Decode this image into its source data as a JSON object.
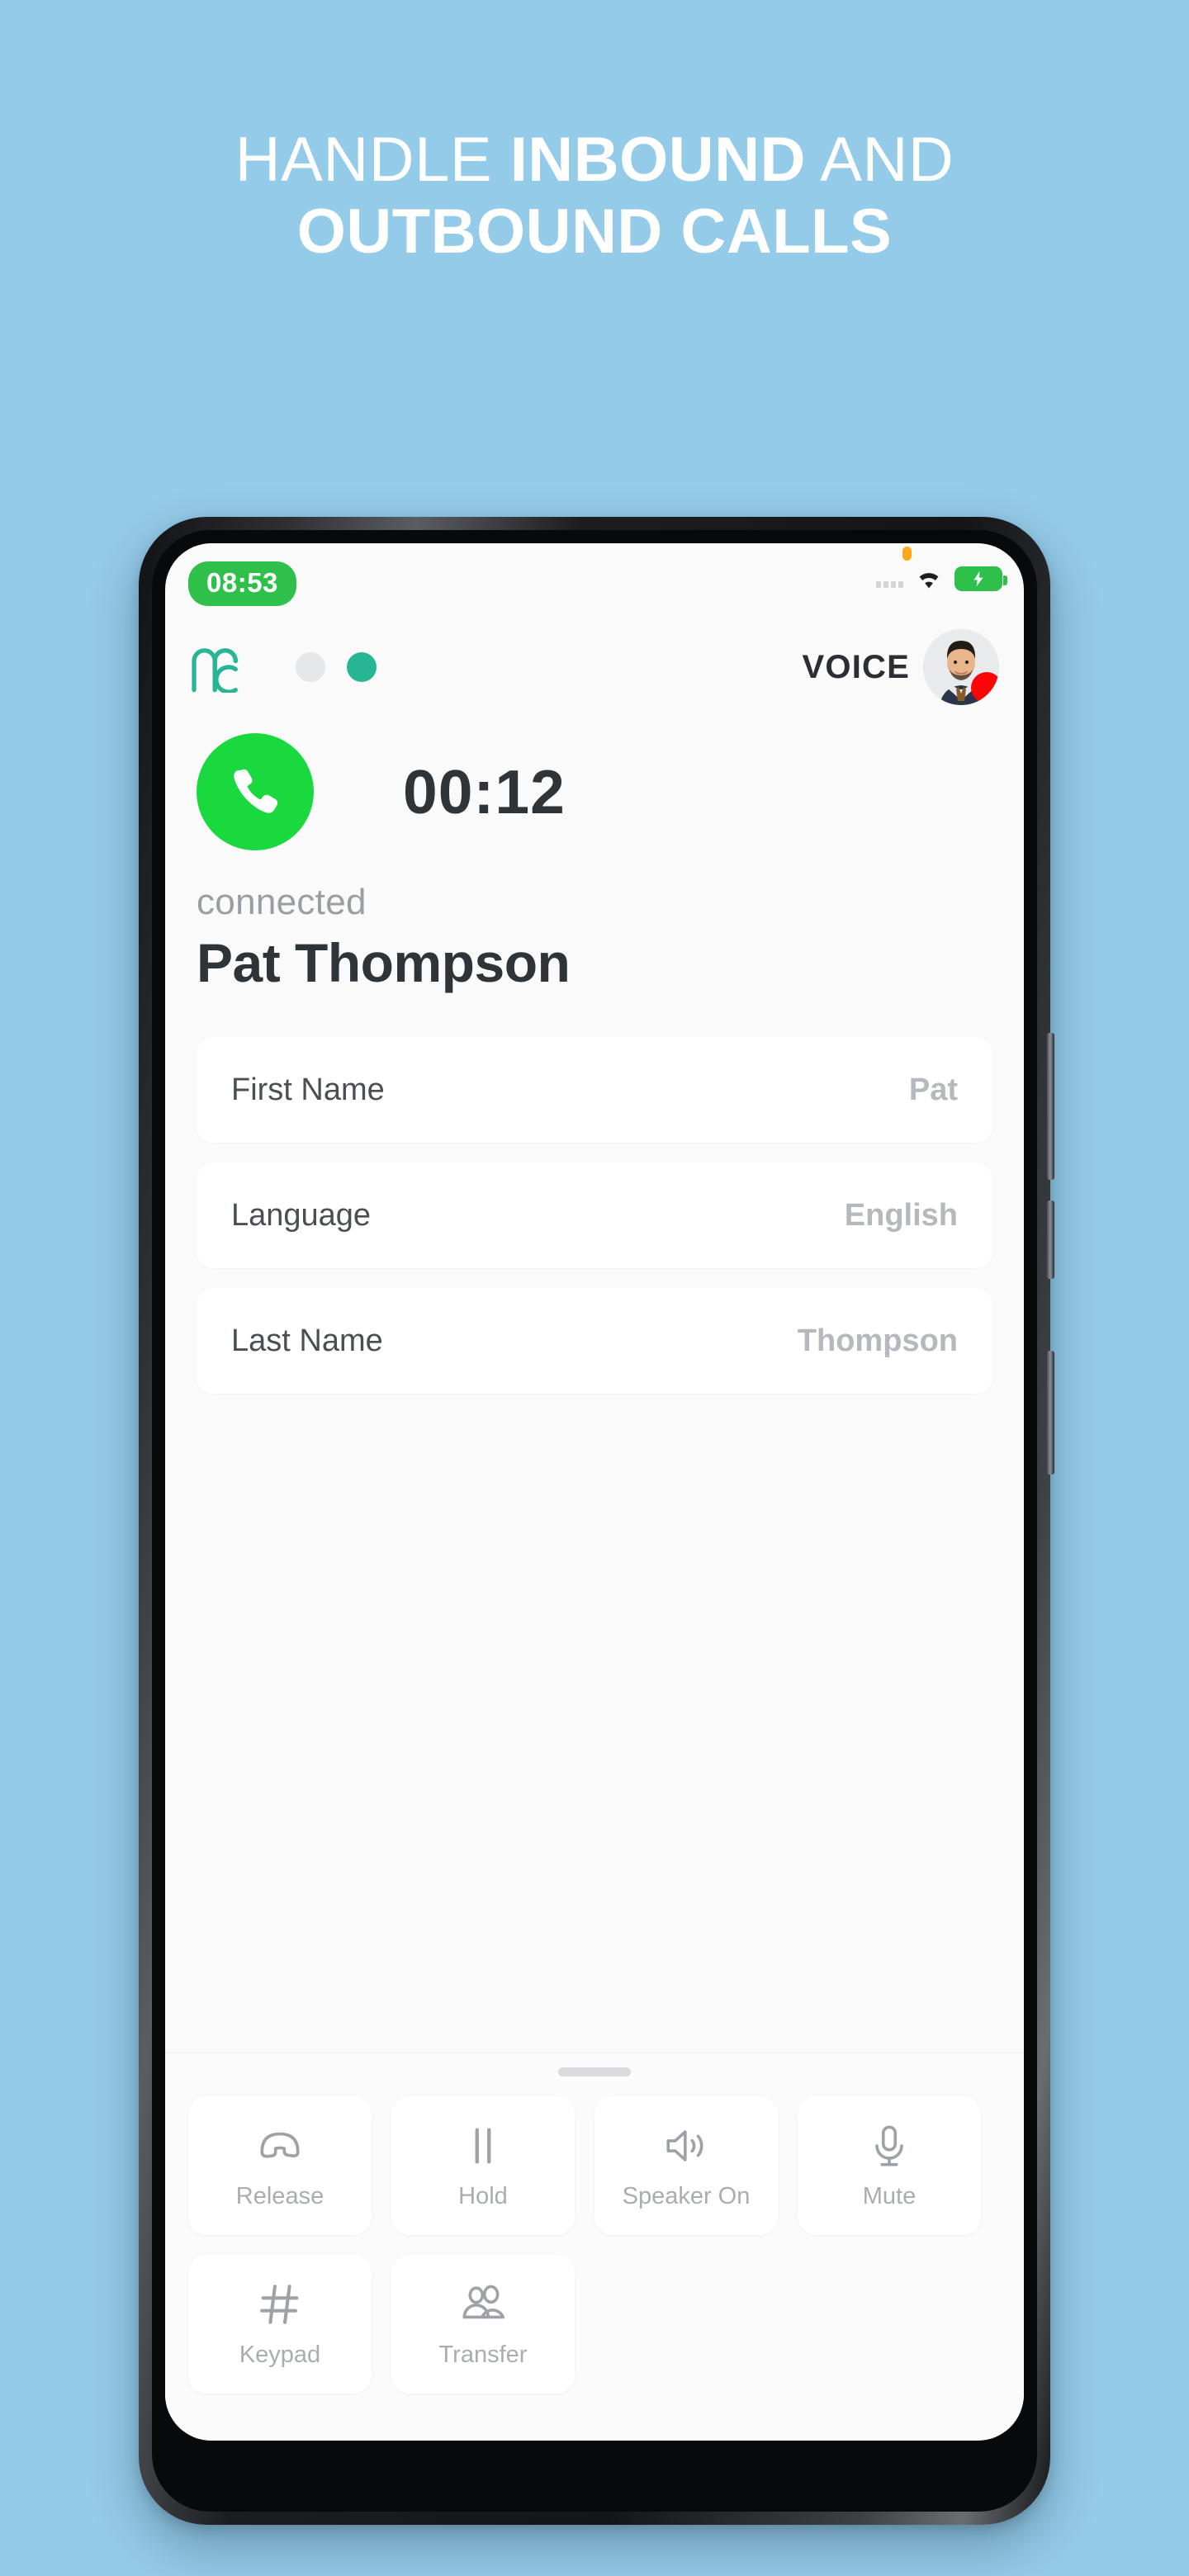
{
  "background_color": "#94cbe8",
  "headline": {
    "line1_light": "HANDLE ",
    "line1_bold": "INBOUND",
    "line1_tail": " AND",
    "line2": "OUTBOUND CALLS"
  },
  "status_bar": {
    "time": "08:53",
    "time_pill_color": "#2ec04b",
    "notification_dot_color": "#ffa716",
    "icons": [
      "signal-dots-icon",
      "wifi-icon",
      "battery-charging-icon"
    ]
  },
  "app_header": {
    "logo": "mc-logo",
    "presence_dots": [
      {
        "name": "presence-dot-inactive",
        "color": "#e6e7e9"
      },
      {
        "name": "presence-dot-active",
        "color": "#27b593"
      }
    ],
    "channel_label": "VOICE",
    "avatar": "agent-avatar",
    "avatar_badge_color": "#fb0606"
  },
  "call": {
    "badge_icon": "phone-icon",
    "badge_color": "#19d93f",
    "timer": "00:12",
    "status": "connected",
    "contact_name": "Pat Thompson"
  },
  "details": [
    {
      "label": "First Name",
      "value": "Pat"
    },
    {
      "label": "Language",
      "value": "English"
    },
    {
      "label": "Last Name",
      "value": "Thompson"
    }
  ],
  "actions_row1": [
    {
      "label": "Release",
      "icon": "hangup-icon"
    },
    {
      "label": "Hold",
      "icon": "pause-icon"
    },
    {
      "label": "Speaker On",
      "icon": "speaker-icon"
    },
    {
      "label": "Mute",
      "icon": "microphone-icon"
    }
  ],
  "actions_row2": [
    {
      "label": "Keypad",
      "icon": "hash-icon"
    },
    {
      "label": "Transfer",
      "icon": "people-icon"
    }
  ]
}
